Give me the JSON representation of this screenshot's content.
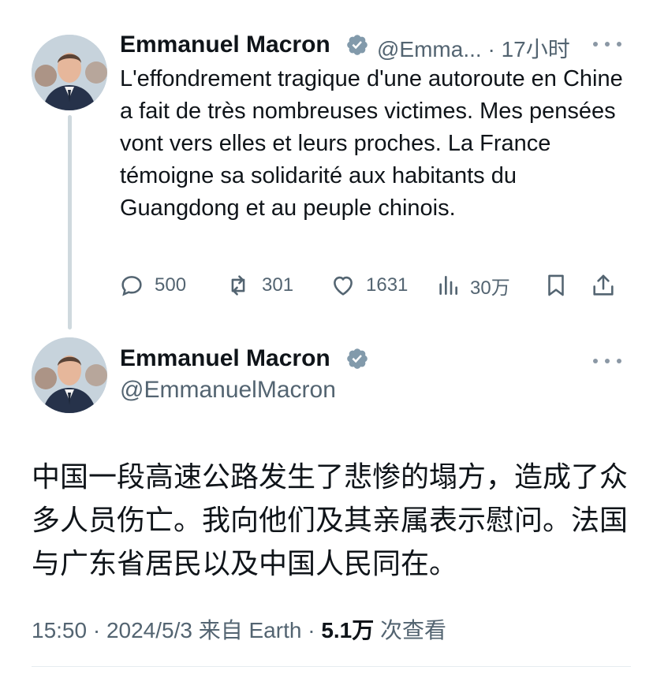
{
  "tweet1": {
    "name": "Emmanuel Macron",
    "handle": "@Emma...",
    "separator": "·",
    "time": "17小时",
    "text": "L'effondrement tragique d'une autoroute en Chine a fait de très nombreuses victimes. Mes pensées vont vers elles et leurs proches. La France témoigne sa solidarité aux habitants du Guangdong et au peuple chinois.",
    "stats": {
      "replies": "500",
      "retweets": "301",
      "likes": "1631",
      "views": "30万"
    }
  },
  "tweet2": {
    "name": "Emmanuel Macron",
    "handle": "@EmmanuelMacron",
    "text": "中国一段高速公路发生了悲惨的塌方，造成了众多人员伤亡。我向他们及其亲属表示慰问。法国与广东省居民以及中国人民同在。",
    "meta": {
      "datetime": "15:50 · 2024/5/3 来自 Earth ·",
      "views_count": "5.1万",
      "views_label": "次查看"
    }
  },
  "colors": {
    "text": "#0f1419",
    "secondary": "#536471",
    "verified_badge": "#829aab",
    "thread_line": "#cfd9de"
  },
  "icons": [
    "verified-icon",
    "more-icon",
    "reply-icon",
    "retweet-icon",
    "like-icon",
    "views-icon",
    "bookmark-icon",
    "share-icon"
  ]
}
